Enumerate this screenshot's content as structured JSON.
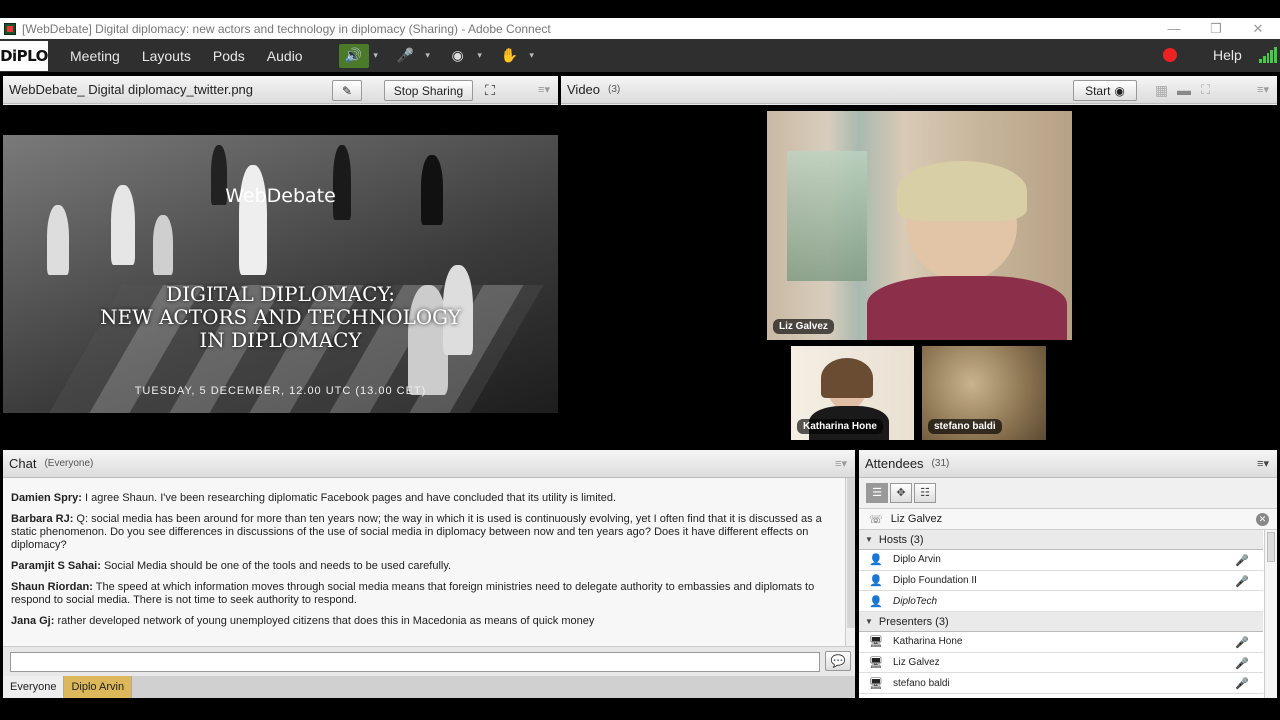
{
  "window": {
    "title": "[WebDebate] Digital diplomacy: new actors and technology in diplomacy (Sharing) - Adobe Connect",
    "minimize": "—",
    "restore": "❐",
    "close": "✕"
  },
  "menubar": {
    "logo": "DiPLO",
    "items": [
      "Meeting",
      "Layouts",
      "Pods",
      "Audio"
    ],
    "help": "Help",
    "icons": {
      "speaker": "🔊",
      "mic": "🎤",
      "camera": "◉",
      "raise_hand": "✋",
      "caret": "▾"
    }
  },
  "share_pod": {
    "title": "WebDebate_ Digital diplomacy_twitter.png",
    "stop_sharing": "Stop Sharing",
    "menu": "≡▾",
    "slide": {
      "heading": "WebDebate",
      "title_lines": [
        "DIGITAL DIPLOMACY:",
        "NEW ACTORS AND TECHNOLOGY",
        "IN DIPLOMACY"
      ],
      "date": "TUESDAY, 5 DECEMBER, 12.00 UTC (13.00 CET)"
    }
  },
  "video_pod": {
    "title": "Video",
    "count": "(3)",
    "start": "Start",
    "menu": "≡▾",
    "cams": [
      {
        "name": "Liz Galvez"
      },
      {
        "name": "Katharina Hone"
      },
      {
        "name": "stefano baldi"
      }
    ]
  },
  "chat_pod": {
    "title": "Chat",
    "scope": "(Everyone)",
    "menu": "≡▾",
    "messages": [
      {
        "author": "Damien Spry:",
        "text": "I agree Shaun. I've been researching diplomatic Facebook pages and have concluded that its utility is limited."
      },
      {
        "author": "Barbara RJ:",
        "text": "Q: social media has been around for more than ten years now; the way in which it is used is continuously evolving, yet I often find that it is discussed as a static phenomenon. Do you see differences in discussions of the use of social media in diplomacy between now and ten years ago? Does it have different effects on diplomacy?"
      },
      {
        "author": "Paramjit S Sahai:",
        "text": "Social Media should be one of the tools and needs to be used carefully."
      },
      {
        "author": "Shaun Riordan:",
        "text": "The speed at which information moves through social media means that foreign ministries need to delegate authority to embassies and diplomats to respond to social media. There is not time to seek authority to respond."
      },
      {
        "author": "Jana Gj:",
        "text": "rather developed network of young unemployed citizens that does this in Macedonia as means of quick money"
      }
    ],
    "input_placeholder": "",
    "tabs": [
      "Everyone",
      "Diplo Arvin"
    ]
  },
  "attendees_pod": {
    "title": "Attendees",
    "count": "(31)",
    "menu": "≡▾",
    "active_speaker": "Liz Galvez",
    "groups": [
      {
        "label": "Hosts (3)",
        "members": [
          {
            "name": "Diplo Arvin",
            "italic": false,
            "mic": "🎤"
          },
          {
            "name": "Diplo Foundation II",
            "italic": false,
            "mic": "🎤"
          },
          {
            "name": "DiploTech",
            "italic": true,
            "mic": ""
          }
        ]
      },
      {
        "label": "Presenters (3)",
        "members": [
          {
            "name": "Katharina Hone",
            "italic": false,
            "mic": "🎤"
          },
          {
            "name": "Liz Galvez",
            "italic": false,
            "mic": "🎤"
          },
          {
            "name": "stefano baldi",
            "italic": false,
            "mic": "🎤"
          }
        ]
      }
    ]
  }
}
